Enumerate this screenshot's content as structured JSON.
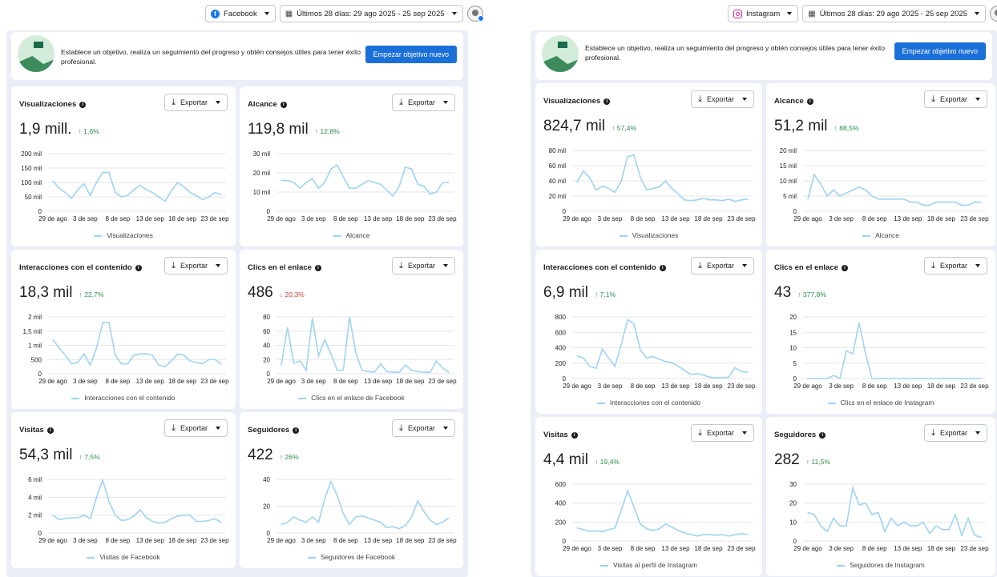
{
  "left": {
    "platform_select": "Facebook",
    "date_range": "Últimos 28 días: 29 ago 2025 - 25 sep 2025",
    "goal_text": "Establece un objetivo, realiza un seguimiento del progreso y obtén consejos útiles para tener éxito profesional.",
    "goal_button": "Empezar objetivo nuevo",
    "export_label": "Exportar",
    "cards": [
      {
        "title": "Visualizaciones",
        "value": "1,9 mill.",
        "change": "↑ 1,6%",
        "trend": "up",
        "legend": "Visualizaciones"
      },
      {
        "title": "Alcance",
        "value": "119,8 mil",
        "change": "↑ 12,8%",
        "trend": "up",
        "legend": "Alcance"
      },
      {
        "title": "Interacciones con el contenido",
        "value": "18,3 mil",
        "change": "↑ 22,7%",
        "trend": "up",
        "legend": "Interacciones con el contenido"
      },
      {
        "title": "Clics en el enlace",
        "value": "486",
        "change": "↓ 20,3%",
        "trend": "down",
        "legend": "Clics en el enlace de Facebook"
      },
      {
        "title": "Visitas",
        "value": "54,3 mil",
        "change": "↑ 7,5%",
        "trend": "up",
        "legend": "Visitas de Facebook"
      },
      {
        "title": "Seguidores",
        "value": "422",
        "change": "↑ 26%",
        "trend": "up",
        "legend": "Seguidores de Facebook"
      }
    ]
  },
  "right": {
    "platform_select": "Instagram",
    "date_range": "Últimos 28 días: 29 ago 2025 - 25 sep 2025",
    "goal_text": "Establece un objetivo, realiza un seguimiento del progreso y obtén consejos útiles para tener éxito profesional.",
    "goal_button": "Empezar objetivo nuevo",
    "export_label": "Exportar",
    "cards": [
      {
        "title": "Visualizaciones",
        "value": "824,7 mil",
        "change": "↑ 57,4%",
        "trend": "up",
        "legend": "Visualizaciones"
      },
      {
        "title": "Alcance",
        "value": "51,2 mil",
        "change": "↑ 88,5%",
        "trend": "up",
        "legend": "Alcance"
      },
      {
        "title": "Interacciones con el contenido",
        "value": "6,9 mil",
        "change": "↑ 7,1%",
        "trend": "up",
        "legend": "Interacciones con el contenido"
      },
      {
        "title": "Clics en el enlace",
        "value": "43",
        "change": "↑ 377,8%",
        "trend": "up",
        "legend": "Clics en el enlace de Instagram"
      },
      {
        "title": "Visitas",
        "value": "4,4 mil",
        "change": "↑ 19,4%",
        "trend": "up",
        "legend": "Visitas al perfil de Instagram"
      },
      {
        "title": "Seguidores",
        "value": "282",
        "change": "↑ 11,5%",
        "trend": "up",
        "legend": "Seguidores de Instagram"
      }
    ]
  },
  "colors": {
    "line": "#9fd3f4",
    "grid": "#e4e6eb",
    "button": "#1b6fd8",
    "up": "#2f8f4e",
    "down": "#d43c3c"
  },
  "chart_data": [
    {
      "type": "line",
      "panel": "Facebook",
      "title": "Visualizaciones",
      "series": [
        {
          "name": "Visualizaciones",
          "values": [
            105,
            80,
            65,
            45,
            75,
            95,
            55,
            100,
            135,
            135,
            65,
            50,
            55,
            75,
            90,
            75,
            65,
            50,
            35,
            70,
            100,
            85,
            65,
            55,
            40,
            50,
            65,
            58
          ]
        }
      ],
      "yticks": [
        "0",
        "50 mil",
        "100 mil",
        "150 mil",
        "200 mil"
      ],
      "ylim": [
        0,
        200
      ],
      "xticks": [
        "29 de ago",
        "3 de sep",
        "8 de sep",
        "13 de sep",
        "18 de sep",
        "23 de sep"
      ]
    },
    {
      "type": "line",
      "panel": "Facebook",
      "title": "Alcance",
      "series": [
        {
          "name": "Alcance",
          "values": [
            16,
            16,
            15,
            12,
            15,
            17,
            12,
            15,
            22,
            24,
            18,
            12,
            12,
            14,
            16,
            15,
            14,
            11,
            8,
            13,
            23,
            22,
            14,
            13,
            9,
            10,
            15,
            15
          ]
        }
      ],
      "yticks": [
        "0",
        "10 mil",
        "20 mil",
        "30 mil"
      ],
      "ylim": [
        0,
        30
      ],
      "xticks": [
        "29 de ago",
        "3 de sep",
        "8 de sep",
        "13 de sep",
        "18 de sep",
        "23 de sep"
      ]
    },
    {
      "type": "line",
      "panel": "Facebook",
      "title": "Interacciones con el contenido",
      "series": [
        {
          "name": "Interacciones con el contenido",
          "values": [
            1.2,
            0.9,
            0.65,
            0.35,
            0.4,
            0.7,
            0.3,
            0.9,
            1.8,
            1.8,
            0.65,
            0.35,
            0.35,
            0.65,
            0.7,
            0.7,
            0.65,
            0.3,
            0.25,
            0.45,
            0.7,
            0.65,
            0.45,
            0.4,
            0.35,
            0.5,
            0.5,
            0.35
          ]
        }
      ],
      "yticks": [
        "0",
        "500",
        "1 mil",
        "1,5 mil",
        "2 mil"
      ],
      "ylim": [
        0,
        2
      ],
      "xticks": [
        "29 de ago",
        "3 de sep",
        "8 de sep",
        "13 de sep",
        "18 de sep",
        "23 de sep"
      ]
    },
    {
      "type": "line",
      "panel": "Facebook",
      "title": "Clics en el enlace",
      "series": [
        {
          "name": "Clics en el enlace de Facebook",
          "values": [
            12,
            65,
            15,
            18,
            5,
            78,
            25,
            48,
            28,
            5,
            5,
            80,
            30,
            5,
            3,
            2,
            14,
            3,
            2,
            2,
            12,
            5,
            3,
            2,
            2,
            18,
            8,
            2
          ]
        }
      ],
      "yticks": [
        "0",
        "20",
        "40",
        "60",
        "80"
      ],
      "ylim": [
        0,
        80
      ],
      "xticks": [
        "29 de ago",
        "3 de sep",
        "8 de sep",
        "13 de sep",
        "18 de sep",
        "23 de sep"
      ]
    },
    {
      "type": "line",
      "panel": "Facebook",
      "title": "Visitas",
      "series": [
        {
          "name": "Visitas de Facebook",
          "values": [
            2.0,
            1.5,
            1.6,
            1.7,
            1.7,
            2.0,
            1.6,
            4.0,
            5.9,
            3.5,
            2.0,
            1.4,
            1.5,
            1.9,
            2.6,
            1.7,
            1.3,
            1.1,
            1.2,
            1.6,
            1.9,
            2.0,
            2.0,
            1.3,
            1.3,
            1.4,
            1.6,
            1.2
          ]
        }
      ],
      "yticks": [
        "0",
        "2 mil",
        "4 mil",
        "6 mil"
      ],
      "ylim": [
        0,
        6
      ],
      "xticks": [
        "29 de ago",
        "3 de sep",
        "8 de sep",
        "13 de sep",
        "18 de sep",
        "23 de sep"
      ]
    },
    {
      "type": "line",
      "panel": "Facebook",
      "title": "Seguidores",
      "series": [
        {
          "name": "Seguidores de Facebook",
          "values": [
            8,
            10,
            15,
            12,
            10,
            15,
            10,
            32,
            48,
            35,
            18,
            8,
            15,
            16,
            14,
            12,
            10,
            5,
            6,
            4,
            7,
            15,
            30,
            20,
            12,
            8,
            10,
            14
          ]
        }
      ],
      "yticks": [
        "0",
        "20",
        "40"
      ],
      "ylim": [
        0,
        50
      ],
      "xticks": [
        "29 de ago",
        "3 de sep",
        "8 de sep",
        "13 de sep",
        "18 de sep",
        "23 de sep"
      ]
    },
    {
      "type": "line",
      "panel": "Instagram",
      "title": "Visualizaciones",
      "series": [
        {
          "name": "Visualizaciones",
          "values": [
            38,
            53,
            44,
            28,
            33,
            30,
            25,
            40,
            72,
            74,
            45,
            28,
            30,
            32,
            40,
            30,
            23,
            15,
            14,
            15,
            17,
            15,
            15,
            14,
            16,
            13,
            15,
            16
          ]
        }
      ],
      "yticks": [
        "0",
        "20 mil",
        "40 mil",
        "60 mil",
        "80 mil"
      ],
      "ylim": [
        0,
        80
      ],
      "xticks": [
        "29 de ago",
        "3 de sep",
        "8 de sep",
        "13 de sep",
        "18 de sep",
        "23 de sep"
      ]
    },
    {
      "type": "line",
      "panel": "Instagram",
      "title": "Alcance",
      "series": [
        {
          "name": "Alcance",
          "values": [
            4,
            12,
            9,
            5,
            7,
            5,
            6,
            7,
            8,
            7,
            5,
            4,
            4,
            4,
            4,
            4,
            3,
            3,
            2,
            2,
            3,
            3,
            3,
            3,
            2,
            2,
            3,
            3
          ]
        }
      ],
      "yticks": [
        "0",
        "5 mil",
        "10 mil",
        "15 mil",
        "20 mil"
      ],
      "ylim": [
        0,
        20
      ],
      "xticks": [
        "29 de ago",
        "3 de sep",
        "8 de sep",
        "13 de sep",
        "18 de sep",
        "23 de sep"
      ]
    },
    {
      "type": "line",
      "panel": "Instagram",
      "title": "Interacciones con el contenido",
      "series": [
        {
          "name": "Interacciones con el contenido",
          "values": [
            330,
            300,
            180,
            150,
            430,
            300,
            180,
            500,
            860,
            800,
            420,
            300,
            320,
            280,
            250,
            230,
            180,
            120,
            60,
            70,
            50,
            20,
            10,
            10,
            20,
            160,
            100,
            90
          ]
        }
      ],
      "yticks": [
        "0",
        "200",
        "400",
        "600",
        "800"
      ],
      "ylim": [
        0,
        900
      ],
      "xticks": [
        "29 de ago",
        "3 de sep",
        "8 de sep",
        "13 de sep",
        "18 de sep",
        "23 de sep"
      ]
    },
    {
      "type": "line",
      "panel": "Instagram",
      "title": "Clics en el enlace",
      "series": [
        {
          "name": "Clics en el enlace de Instagram",
          "values": [
            0,
            0,
            0,
            0,
            1,
            0,
            9,
            8,
            18,
            8,
            0,
            0,
            0,
            0,
            0,
            0,
            0,
            0,
            0,
            0,
            0,
            0,
            0,
            0,
            0,
            0,
            0,
            0
          ]
        }
      ],
      "yticks": [
        "0",
        "5",
        "10",
        "15",
        "20"
      ],
      "ylim": [
        0,
        20
      ],
      "xticks": [
        "29 de ago",
        "3 de sep",
        "8 de sep",
        "13 de sep",
        "18 de sep",
        "23 de sep"
      ]
    },
    {
      "type": "line",
      "panel": "Instagram",
      "title": "Visitas",
      "series": [
        {
          "name": "Visitas al perfil de Instagram",
          "values": [
            160,
            140,
            120,
            125,
            115,
            140,
            160,
            380,
            620,
            420,
            210,
            150,
            130,
            150,
            210,
            170,
            130,
            100,
            80,
            60,
            80,
            80,
            70,
            80,
            60,
            80,
            90,
            80
          ]
        }
      ],
      "yticks": [
        "0",
        "200",
        "400",
        "600"
      ],
      "ylim": [
        0,
        700
      ],
      "xticks": [
        "29 de ago",
        "3 de sep",
        "8 de sep",
        "13 de sep",
        "18 de sep",
        "23 de sep"
      ]
    },
    {
      "type": "line",
      "panel": "Instagram",
      "title": "Seguidores",
      "series": [
        {
          "name": "Seguidores de Instagram",
          "values": [
            15,
            14,
            8,
            5,
            12,
            8,
            8,
            28,
            19,
            20,
            14,
            15,
            5,
            12,
            8,
            10,
            8,
            8,
            10,
            4,
            8,
            6,
            6,
            14,
            3,
            12,
            3,
            2
          ]
        }
      ],
      "yticks": [
        "0",
        "10",
        "20",
        "30"
      ],
      "ylim": [
        0,
        30
      ],
      "xticks": [
        "29 de ago",
        "3 de sep",
        "8 de sep",
        "13 de sep",
        "18 de sep",
        "23 de sep"
      ]
    }
  ]
}
